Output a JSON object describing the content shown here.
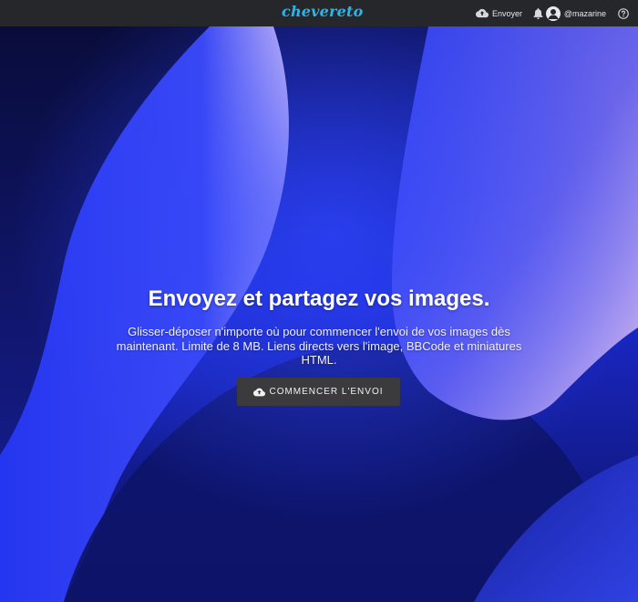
{
  "header": {
    "logo_text": "chevereto",
    "upload_label": "Envoyer",
    "username": "@mazarine",
    "icons": {
      "upload": "cloud-upload-icon",
      "notifications": "bell-icon",
      "user": "user-avatar-icon",
      "help": "help-circle-icon"
    }
  },
  "hero": {
    "title": "Envoyez et partagez vos images.",
    "description": "Glisser-déposer n'importe où pour commencer l'envoi de vos images dès maintenant. Limite de 8 MB. Liens directs vers l'image, BBCode et miniatures HTML.",
    "cta_label": "COMMENCER L'ENVOI"
  },
  "colors": {
    "topbar": "#26272b",
    "logo": "#2cb5e8",
    "button": "#3b3b3e",
    "hero_blue": "#2431e6",
    "hero_dark": "#0a0e3f",
    "hero_lavender": "#c9b6f2"
  }
}
